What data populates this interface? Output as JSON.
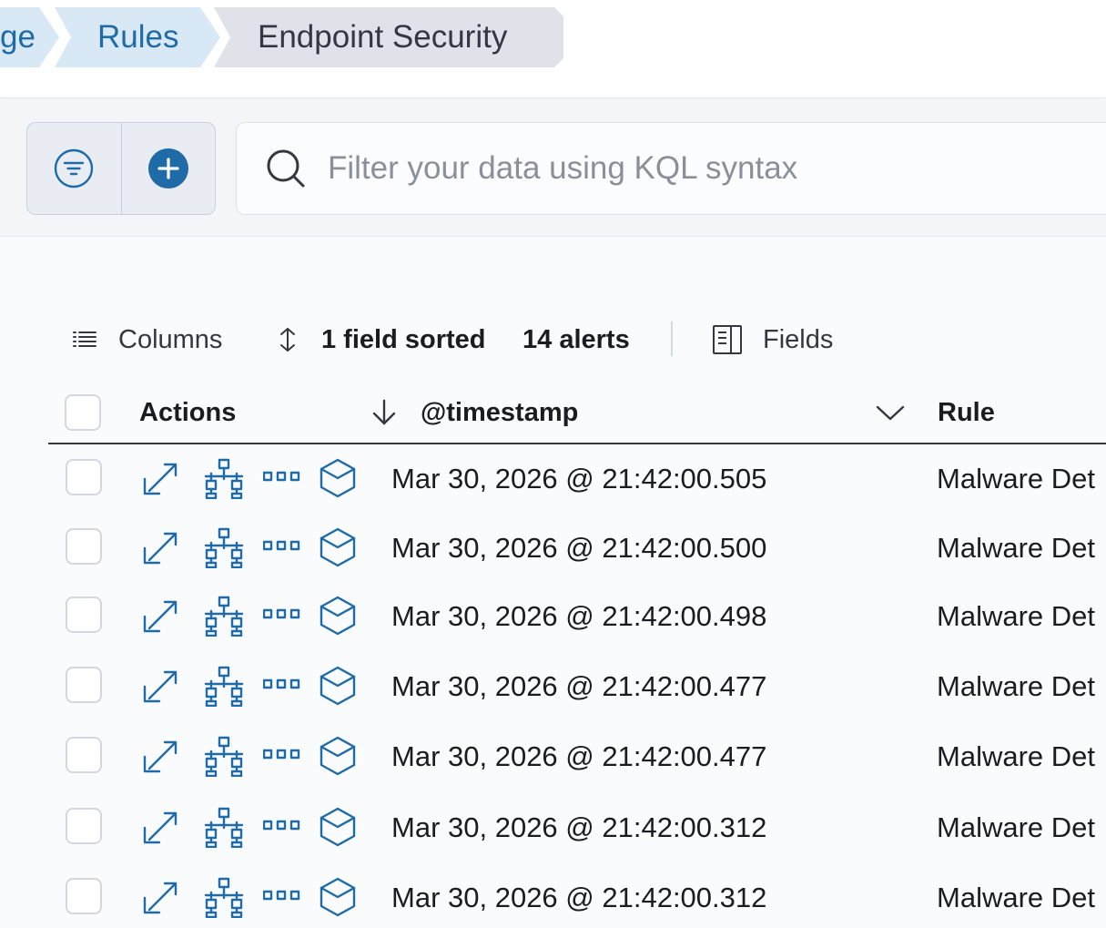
{
  "breadcrumbs": [
    {
      "label": "ge"
    },
    {
      "label": "Rules"
    },
    {
      "label": "Endpoint Security"
    }
  ],
  "query": {
    "placeholder": "Filter your data using KQL syntax",
    "value": ""
  },
  "toolbar": {
    "columns_label": "Columns",
    "sorted_label": "1 field sorted",
    "alerts_label": "14 alerts",
    "fields_label": "Fields"
  },
  "table": {
    "headers": {
      "actions": "Actions",
      "timestamp": "@timestamp",
      "rule": "Rule"
    },
    "rows": [
      {
        "timestamp": "Mar 30, 2026 @ 21:42:00.505",
        "rule": "Malware Det"
      },
      {
        "timestamp": "Mar 30, 2026 @ 21:42:00.500",
        "rule": "Malware Det"
      },
      {
        "timestamp": "Mar 30, 2026 @ 21:42:00.498",
        "rule": "Malware Det"
      },
      {
        "timestamp": "Mar 30, 2026 @ 21:42:00.477",
        "rule": "Malware Det"
      },
      {
        "timestamp": "Mar 30, 2026 @ 21:42:00.477",
        "rule": "Malware Det"
      },
      {
        "timestamp": "Mar 30, 2026 @ 21:42:00.312",
        "rule": "Malware Det"
      },
      {
        "timestamp": "Mar 30, 2026 @ 21:42:00.312",
        "rule": "Malware Det"
      }
    ]
  },
  "icons": {
    "filter": "filter-icon",
    "add": "plus-circle-icon",
    "search": "search-icon",
    "columns": "list-icon",
    "sort": "sort-icon",
    "fields": "fields-panel-icon",
    "sort_desc": "arrow-down-icon",
    "column_menu": "chevron-down-icon",
    "expand": "expand-icon",
    "analyze": "analyze-graph-icon",
    "more": "more-dots-icon",
    "session": "cube-icon"
  },
  "colors": {
    "accent": "#1f6ba8",
    "breadcrumb_bg": "#d9e8f5",
    "breadcrumb_active_bg": "#dfe2e8"
  }
}
